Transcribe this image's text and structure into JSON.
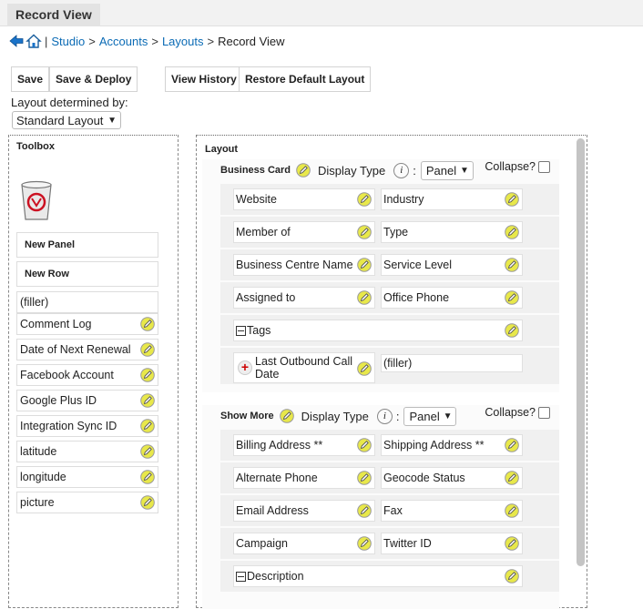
{
  "window": {
    "tab_title": "Record View"
  },
  "breadcrumb": {
    "items": [
      "Studio",
      "Accounts",
      "Layouts"
    ],
    "separator": ">",
    "divider": "|",
    "current": "Record View"
  },
  "toolbar": {
    "save": "Save",
    "save_deploy": "Save & Deploy",
    "view_history": "View History",
    "restore_default": "Restore Default Layout"
  },
  "layout_determined": {
    "label": "Layout determined by:",
    "value": "Standard Layout"
  },
  "toolbox": {
    "title": "Toolbox",
    "new_panel": "New Panel",
    "new_row": "New Row",
    "filler": "(filler)",
    "fields": [
      "Comment Log",
      "Date of Next Renewal",
      "Facebook Account",
      "Google Plus ID",
      "Integration Sync ID",
      "latitude",
      "longitude",
      "picture"
    ]
  },
  "layout": {
    "title": "Layout",
    "display_type_label": "Display Type",
    "colon": ":",
    "collapse_label": "Collapse?",
    "panels": [
      {
        "name": "Business Card",
        "display_type": "Panel",
        "rows": [
          [
            "Website",
            "Industry"
          ],
          [
            "Member of",
            "Type"
          ],
          [
            "Business Centre Name",
            "Service Level"
          ],
          [
            "Assigned to",
            "Office Phone"
          ],
          [
            "Tags"
          ],
          [
            "Last Outbound Call Date",
            "(filler)"
          ]
        ]
      },
      {
        "name": "Show More",
        "display_type": "Panel",
        "rows": [
          [
            "Billing Address **",
            "Shipping Address **"
          ],
          [
            "Alternate Phone",
            "Geocode Status"
          ],
          [
            "Email Address",
            "Fax"
          ],
          [
            "Campaign",
            "Twitter ID"
          ],
          [
            "Description"
          ]
        ]
      }
    ]
  },
  "colors": {
    "link": "#0b6bb5",
    "pencil": "#e8e84a",
    "trash": "#cc1122",
    "nav_arrow": "#1a73c9"
  },
  "icons": [
    "back-arrow-icon",
    "home-icon",
    "trash-icon",
    "pencil-icon",
    "info-icon",
    "plus-icon",
    "minus-icon",
    "chevron-down-icon"
  ]
}
